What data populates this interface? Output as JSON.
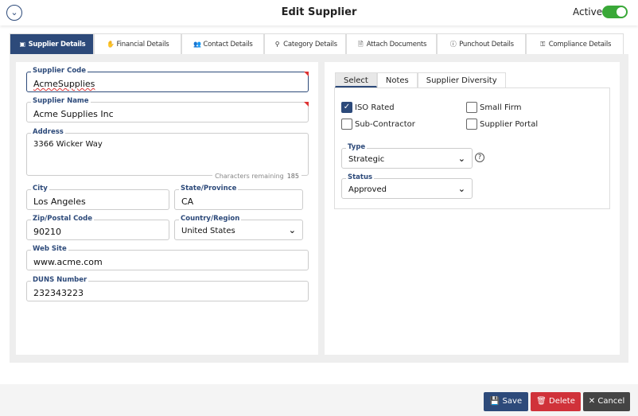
{
  "header": {
    "title": "Edit Supplier",
    "active_label": "Active",
    "active": true
  },
  "tabs": [
    {
      "label": "Supplier Details",
      "icon": "id-card-icon",
      "glyph": "▣",
      "active": true
    },
    {
      "label": "Financial Details",
      "icon": "hand-money-icon",
      "glyph": "✋",
      "active": false
    },
    {
      "label": "Contact Details",
      "icon": "users-icon",
      "glyph": "👥",
      "active": false
    },
    {
      "label": "Category Details",
      "icon": "map-pin-icon",
      "glyph": "⚲",
      "active": false
    },
    {
      "label": "Attach Documents",
      "icon": "document-icon",
      "glyph": "🗎",
      "active": false
    },
    {
      "label": "Punchout Details",
      "icon": "info-icon",
      "glyph": "ⓘ",
      "active": false
    },
    {
      "label": "Compliance Details",
      "icon": "key-icon",
      "glyph": "⚿",
      "active": false
    }
  ],
  "form": {
    "supplier_code": {
      "label": "Supplier Code",
      "value": "AcmeSupplies"
    },
    "supplier_name": {
      "label": "Supplier Name",
      "value": "Acme Supplies Inc"
    },
    "address": {
      "label": "Address",
      "value": "3366 Wicker Way",
      "chars_label": "Characters remaining",
      "chars_remaining": "185"
    },
    "city": {
      "label": "City",
      "value": "Los Angeles"
    },
    "state": {
      "label": "State/Province",
      "value": "CA"
    },
    "zip": {
      "label": "Zip/Postal Code",
      "value": "90210"
    },
    "country": {
      "label": "Country/Region",
      "value": "United States"
    },
    "website": {
      "label": "Web Site",
      "value": "www.acme.com"
    },
    "duns": {
      "label": "DUNS Number",
      "value": "232343223"
    }
  },
  "side": {
    "tabs": [
      "Select",
      "Notes",
      "Supplier Diversity"
    ],
    "checkboxes": [
      {
        "label": "ISO Rated",
        "checked": true
      },
      {
        "label": "Small Firm",
        "checked": false
      },
      {
        "label": "Sub-Contractor",
        "checked": false
      },
      {
        "label": "Supplier Portal",
        "checked": false
      }
    ],
    "type": {
      "label": "Type",
      "value": "Strategic"
    },
    "status": {
      "label": "Status",
      "value": "Approved"
    }
  },
  "footer": {
    "save": "Save",
    "delete": "Delete",
    "cancel": "Cancel"
  },
  "colors": {
    "primary": "#2d4a7a",
    "danger": "#d0323a",
    "dark": "#444444",
    "toggle": "#3aa838"
  }
}
